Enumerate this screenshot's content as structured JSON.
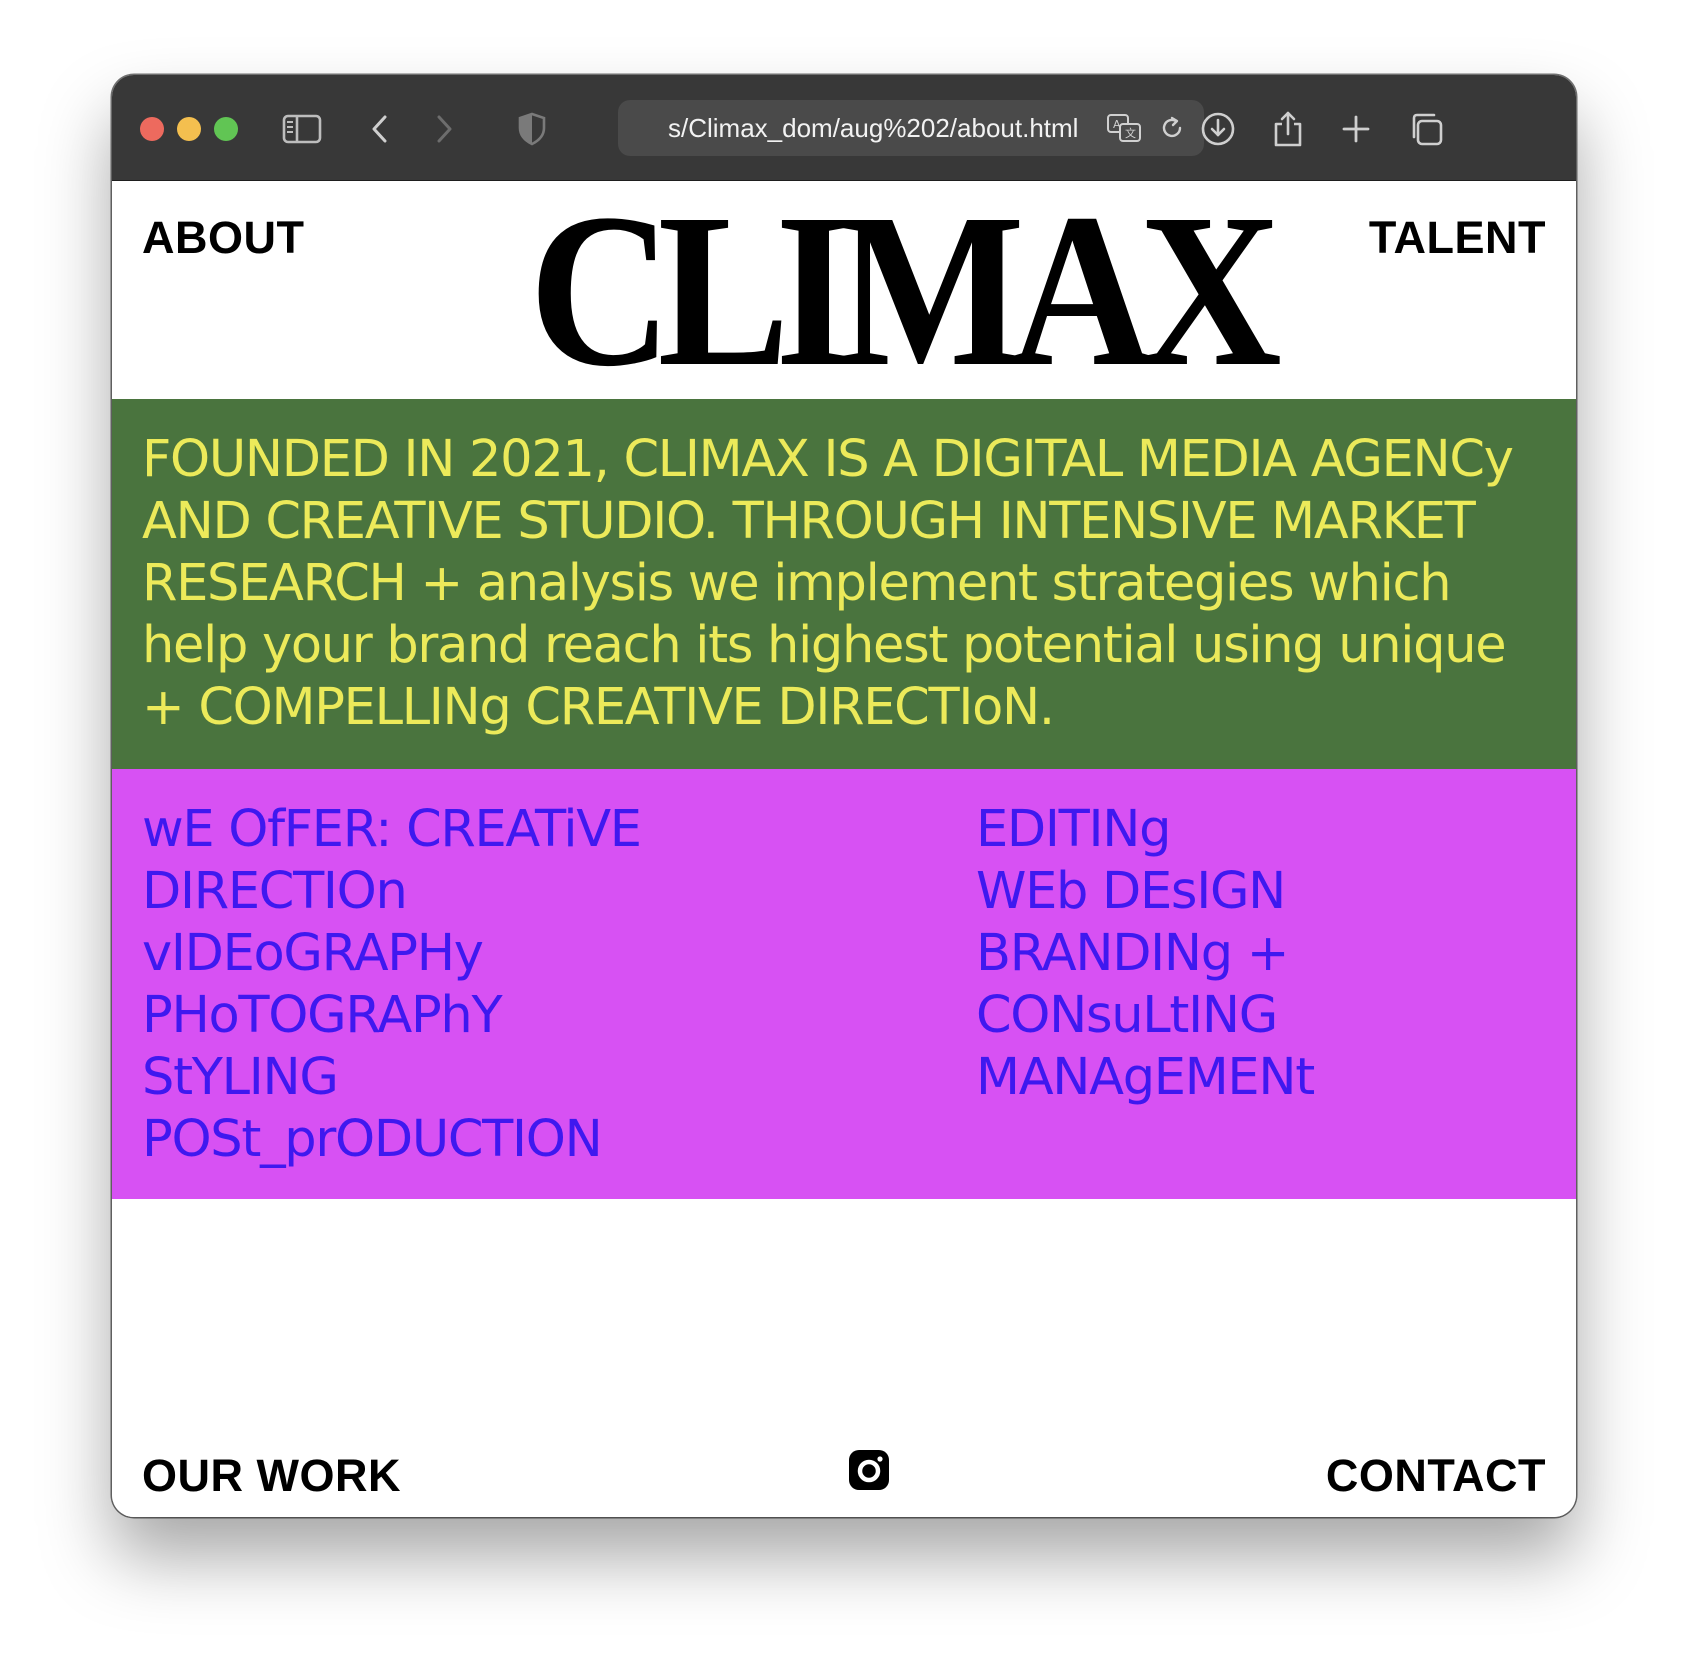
{
  "browser": {
    "url": "s/Climax_dom/aug%202/about.html",
    "icons": [
      "sidebar-icon",
      "back-icon",
      "forward-icon",
      "shield-icon",
      "translate-icon",
      "reload-icon",
      "download-icon",
      "share-icon",
      "new-tab-icon",
      "tabs-overview-icon"
    ],
    "traffic_lights": {
      "close": "#ed6a5e",
      "minimize": "#f4bf4f",
      "zoom": "#61c554"
    }
  },
  "header": {
    "left_link": "ABOUT",
    "logo": "CLIMAX",
    "right_link": "TALENT"
  },
  "about": {
    "background": "#4a743e",
    "text_color": "#ecea5a",
    "paragraph": "FOUNDED IN 2021, CLIMAX IS A DIGITAL MEDIA AGENCy AND CREATIVE STUDIO. THROUGH INTENSIVE MARKET RESEARCH + analysis we implement strategies which help your brand reach its highest potential using unique + COMPELLINg CREATIVE DIRECTIoN."
  },
  "services": {
    "background": "#d751f3",
    "text_color": "#3f18ef",
    "left_column": [
      "wE OfFER: CREATiVE",
      "DIRECTIOn",
      "vIDEoGRAPHy",
      "PHoTOGRAPhY",
      "StYLING",
      "POSt_prODUCTION"
    ],
    "right_column": [
      "EDITINg",
      "WEb DEsIGN",
      "BRANDINg +",
      "CONsuLtING",
      "MANAgEMENt"
    ]
  },
  "footer": {
    "left_link": "OUR WORK",
    "center_icon": "instagram-icon",
    "right_link": "CONTACT"
  }
}
